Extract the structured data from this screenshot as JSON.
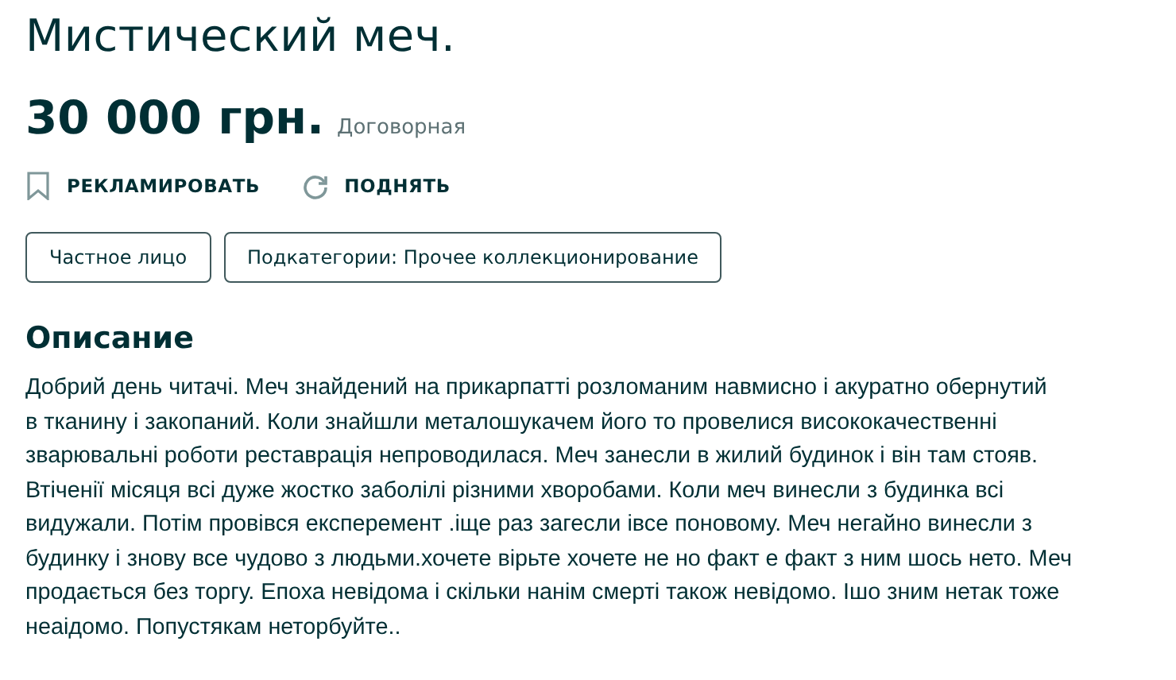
{
  "title": "Мистический меч.",
  "price": {
    "amount": "30 000 грн.",
    "note": "Договорная"
  },
  "actions": [
    {
      "kind": "bookmark",
      "label": "РЕКЛАМИРОВАТЬ"
    },
    {
      "kind": "refresh",
      "label": "ПОДНЯТЬ"
    }
  ],
  "tags": [
    "Частное лицо",
    "Подкатегории: Прочее коллекционирование"
  ],
  "description": {
    "heading": "Описание",
    "lines": [
      "Добрий день читачі. Меч знайдений на прикарпатті розломаним навмисно і акуратно обернутий",
      "в тканину і закопаний. Коли знайшли металошукачем його то провелися висококачественні",
      "зварювальні роботи реставрація непроводилася. Меч занесли в жилий будинок і він там стояв.",
      "Втіченії місяця всі дуже жостко заболілі різними хворобами. Коли меч винесли з будинка всі",
      "видужали. Потім провівся експеремент .іще раз загесли івсе поновому. Меч негайно винесли з",
      "будинку і знову все чудово з людьми.хочете вірьте хочете не но факт е факт з ним шось нето. Меч",
      "продається без торгу. Епоха невідома і скільки нанім смерті також невідомо. Ішо зним нетак тоже",
      "неаідомо. Попустякам неторбуйте.."
    ]
  }
}
